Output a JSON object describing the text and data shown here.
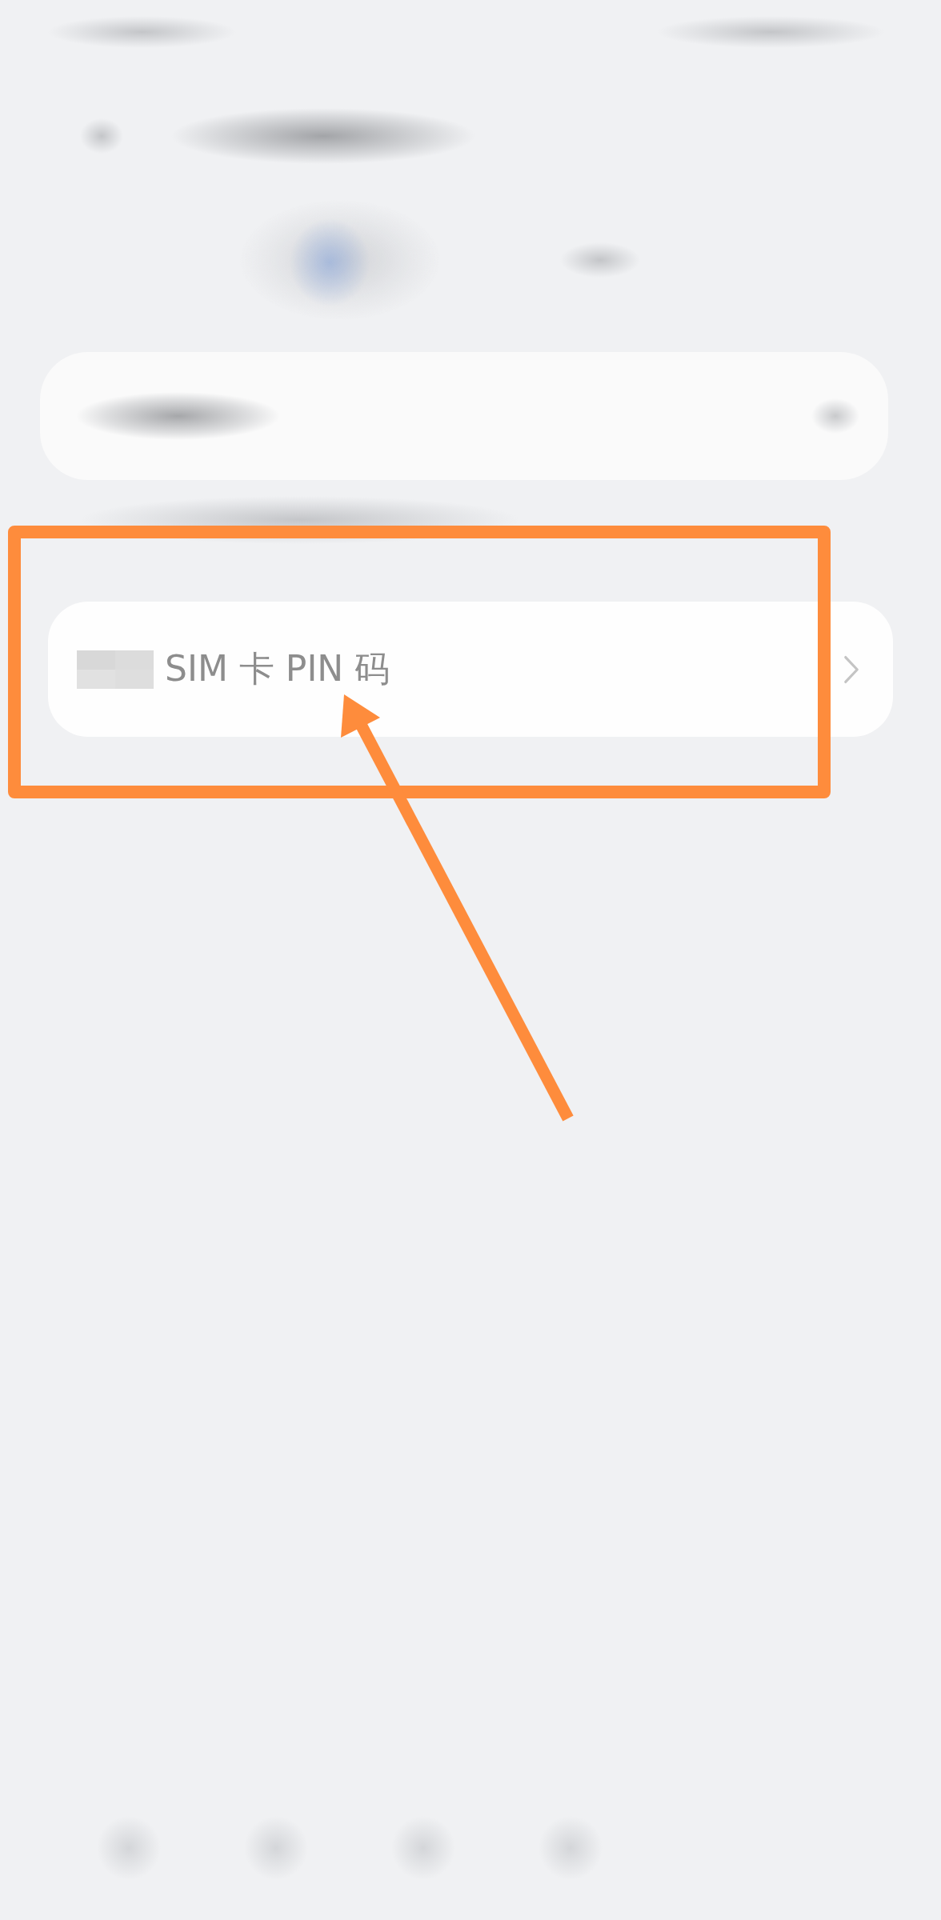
{
  "list": [
    {
      "label": "SIM 卡 PIN 码",
      "kind": "link"
    }
  ]
}
